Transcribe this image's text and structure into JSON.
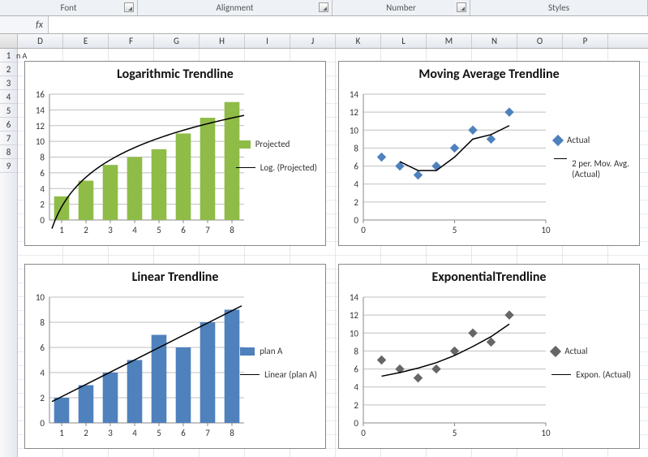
{
  "ribbon": {
    "groups": [
      "Font",
      "Alignment",
      "Number",
      "Styles"
    ]
  },
  "formula_bar": {
    "fx_label": "fx",
    "value": ""
  },
  "columns": [
    "D",
    "E",
    "F",
    "G",
    "H",
    "I",
    "J",
    "K",
    "L",
    "M",
    "N",
    "O",
    "P"
  ],
  "rows_visible_partial": [
    "1",
    "2",
    "3",
    "4",
    "5",
    "6",
    "7",
    "8",
    "9"
  ],
  "partial_cell_left": "n A",
  "charts": {
    "log": {
      "title": "Logarithmic Trendline",
      "legend_series": "Projected",
      "legend_trend": "Log. (Projected)"
    },
    "movavg": {
      "title": "Moving Average Trendline",
      "legend_series": "Actual",
      "legend_trend": "2 per. Mov. Avg. (Actual)"
    },
    "linear": {
      "title": "Linear Trendline",
      "legend_series": "plan A",
      "legend_trend": "Linear (plan A)"
    },
    "expo": {
      "title": "ExponentialTrendline",
      "legend_series": "Actual",
      "legend_trend": "Expon. (Actual)"
    }
  },
  "chart_data": [
    {
      "id": "log",
      "type": "bar",
      "title": "Logarithmic Trendline",
      "categories": [
        1,
        2,
        3,
        4,
        5,
        6,
        7,
        8
      ],
      "series": [
        {
          "name": "Projected",
          "values": [
            3,
            5,
            7,
            8,
            9,
            11,
            13,
            15
          ],
          "color": "#8fbc47"
        }
      ],
      "trendline": {
        "type": "logarithmic",
        "name": "Log. (Projected)"
      },
      "ylabel": "",
      "xlabel": "",
      "ylim": [
        0,
        16
      ],
      "yticks": [
        0,
        2,
        4,
        6,
        8,
        10,
        12,
        14,
        16
      ]
    },
    {
      "id": "movavg",
      "type": "scatter",
      "title": "Moving Average Trendline",
      "x": [
        1,
        2,
        3,
        4,
        5,
        6,
        7,
        8
      ],
      "series": [
        {
          "name": "Actual",
          "values": [
            7,
            6,
            5,
            6,
            8,
            10,
            9,
            12
          ],
          "color": "#4f81bd"
        }
      ],
      "trendline": {
        "type": "moving_average",
        "period": 2,
        "name": "2 per. Mov. Avg. (Actual)",
        "points": [
          [
            2,
            6.5
          ],
          [
            3,
            5.5
          ],
          [
            4,
            5.5
          ],
          [
            5,
            7
          ],
          [
            6,
            9
          ],
          [
            7,
            9.5
          ],
          [
            8,
            10.5
          ]
        ]
      },
      "ylabel": "",
      "xlabel": "",
      "xlim": [
        0,
        10
      ],
      "ylim": [
        0,
        14
      ],
      "yticks": [
        0,
        2,
        4,
        6,
        8,
        10,
        12,
        14
      ],
      "xticks": [
        0,
        5,
        10
      ]
    },
    {
      "id": "linear",
      "type": "bar",
      "title": "Linear Trendline",
      "categories": [
        1,
        2,
        3,
        4,
        5,
        6,
        7,
        8
      ],
      "series": [
        {
          "name": "plan A",
          "values": [
            2,
            3,
            4,
            5,
            7,
            6,
            8,
            9
          ],
          "color": "#4f81bd"
        }
      ],
      "trendline": {
        "type": "linear",
        "name": "Linear (plan A)"
      },
      "ylabel": "",
      "xlabel": "",
      "ylim": [
        0,
        10
      ],
      "yticks": [
        0,
        2,
        4,
        6,
        8,
        10
      ]
    },
    {
      "id": "expo",
      "type": "scatter",
      "title": "ExponentialTrendline",
      "x": [
        1,
        2,
        3,
        4,
        5,
        6,
        7,
        8
      ],
      "series": [
        {
          "name": "Actual",
          "values": [
            7,
            6,
            5,
            6,
            8,
            10,
            9,
            12
          ],
          "color": "#666666"
        }
      ],
      "trendline": {
        "type": "exponential",
        "name": "Expon. (Actual)",
        "points": [
          [
            1,
            5.2
          ],
          [
            2,
            5.6
          ],
          [
            3,
            6.1
          ],
          [
            4,
            6.7
          ],
          [
            5,
            7.5
          ],
          [
            6,
            8.5
          ],
          [
            7,
            9.6
          ],
          [
            8,
            11
          ]
        ]
      },
      "ylabel": "",
      "xlabel": "",
      "xlim": [
        0,
        10
      ],
      "ylim": [
        0,
        14
      ],
      "yticks": [
        0,
        2,
        4,
        6,
        8,
        10,
        12,
        14
      ],
      "xticks": [
        0,
        5,
        10
      ]
    }
  ]
}
